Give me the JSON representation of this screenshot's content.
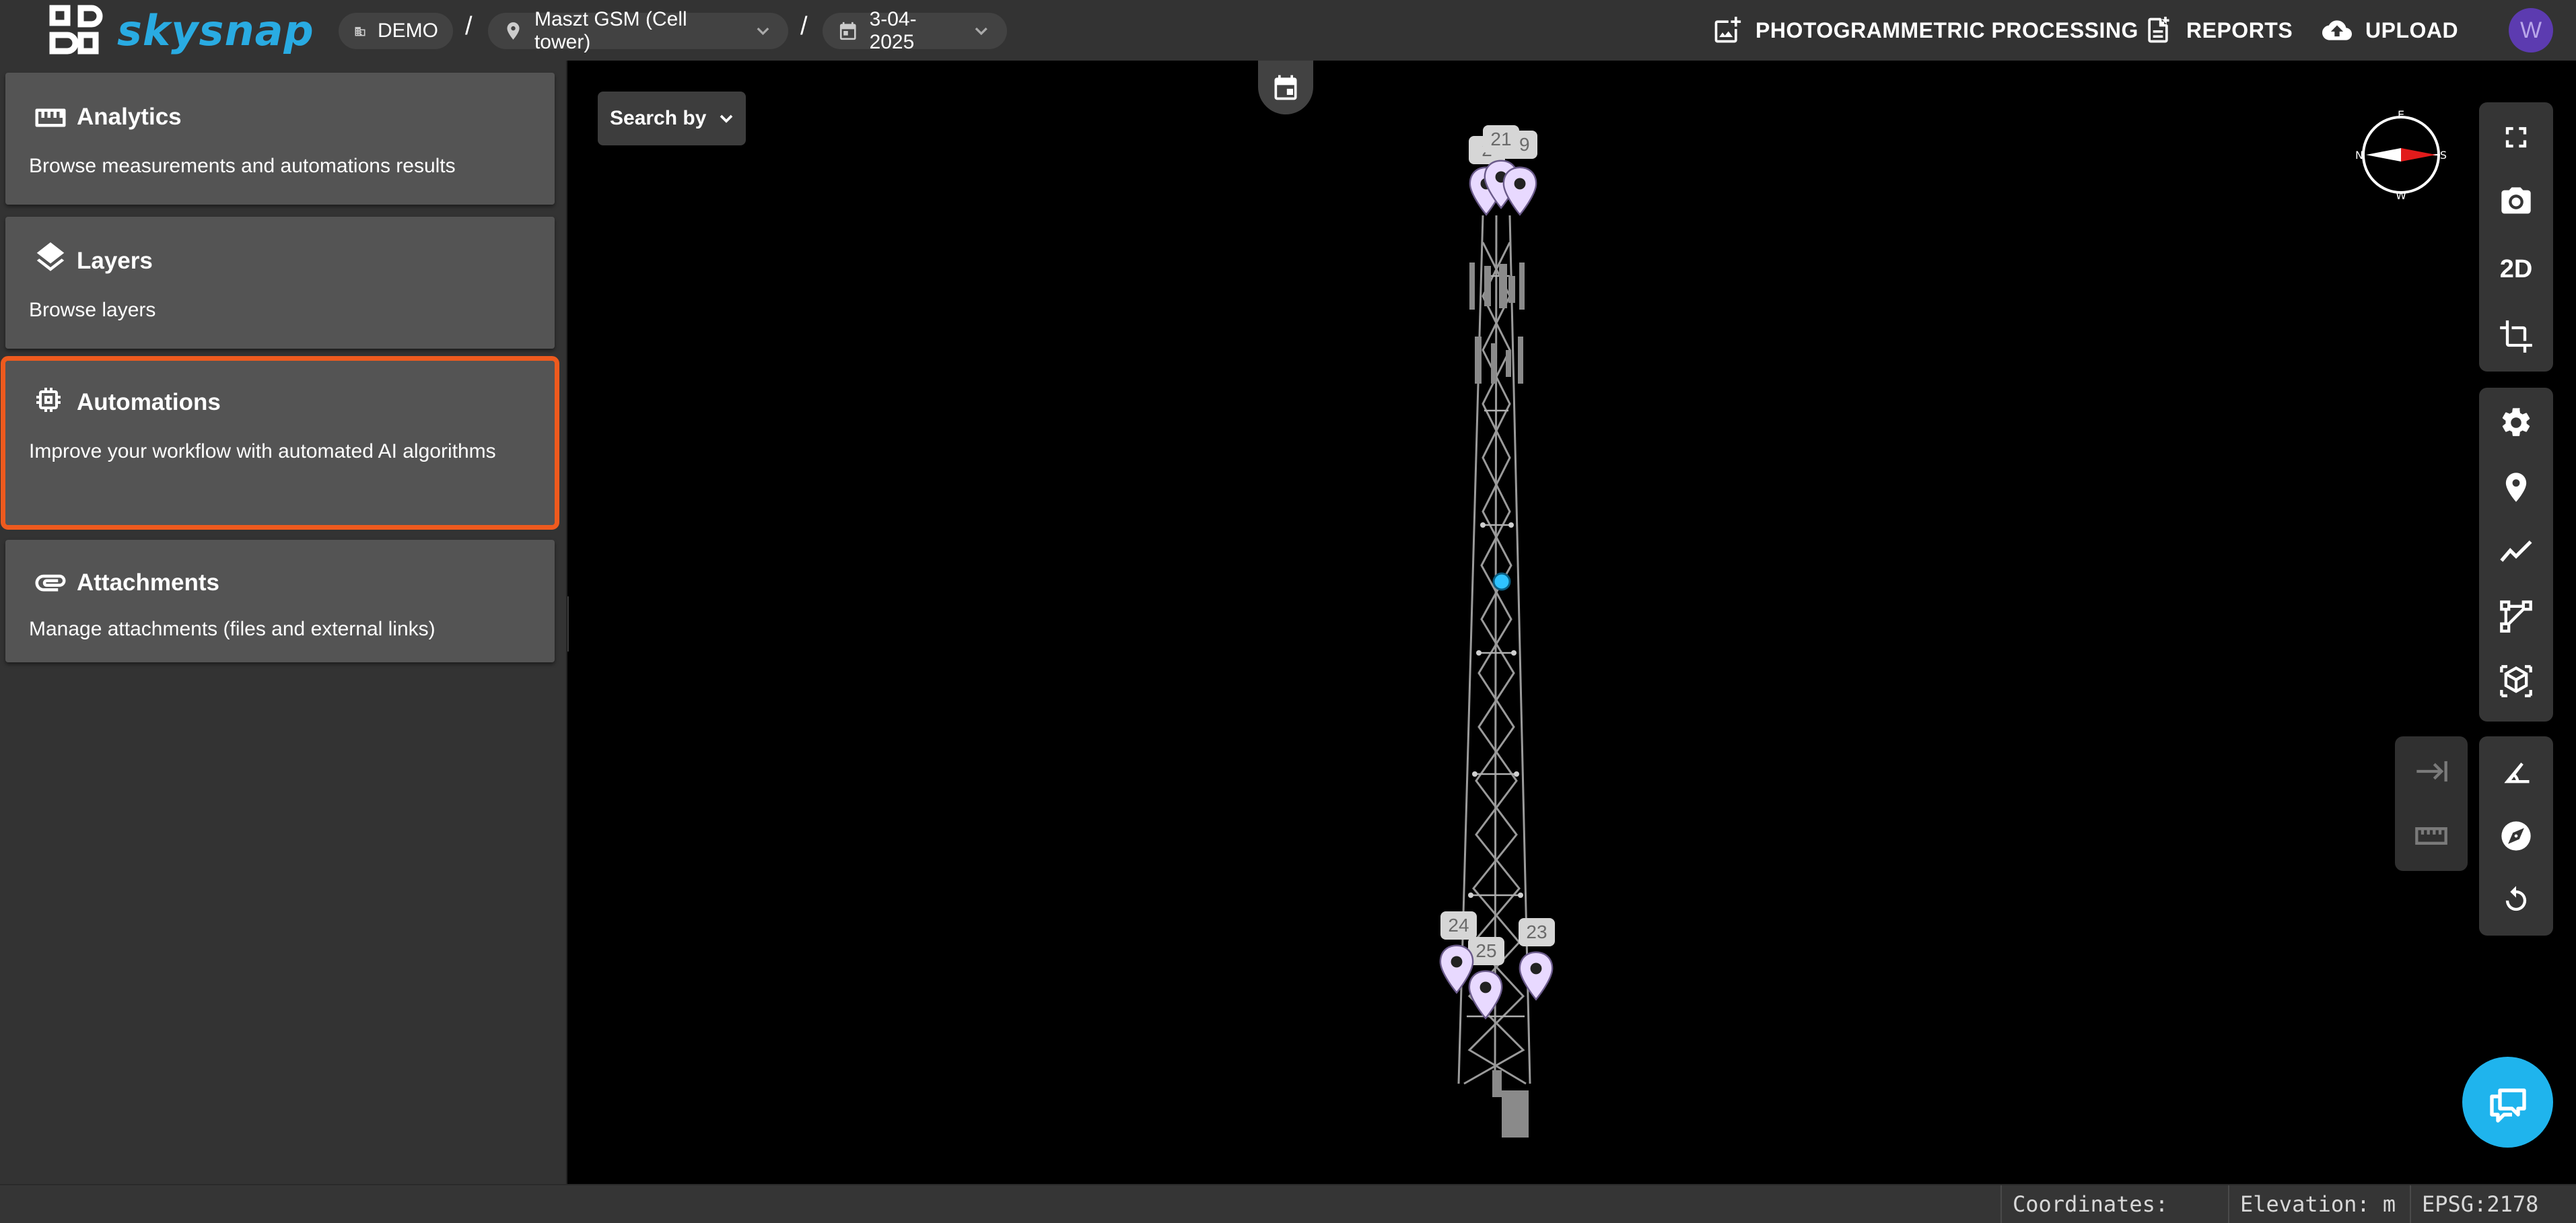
{
  "app": {
    "brand": "skysnap",
    "accent": "#29abe2",
    "selected_outline": "#ee5a1e"
  },
  "breadcrumb": {
    "org": "DEMO",
    "site": "Maszt GSM (Cell tower)",
    "date": "3-04-2025",
    "separator": "/"
  },
  "header_actions": {
    "photogrammetric": "PHOTOGRAMMETRIC PROCESSING",
    "reports": "REPORTS",
    "upload": "UPLOAD",
    "avatar_initial": "W"
  },
  "sidebar": {
    "cards": [
      {
        "title": "Analytics",
        "desc": "Browse measurements and automations results",
        "icon": "ruler-icon"
      },
      {
        "title": "Layers",
        "desc": "Browse layers",
        "icon": "layers-icon"
      },
      {
        "title": "Automations",
        "desc": "Improve your workflow with automated AI algorithms",
        "icon": "chip-icon",
        "selected": true
      },
      {
        "title": "Attachments",
        "desc": "Manage attachments (files and external links)",
        "icon": "paperclip-icon"
      }
    ]
  },
  "viewer": {
    "search_by": "Search by",
    "markers": [
      "21",
      "19",
      "2",
      "24",
      "25",
      "23"
    ]
  },
  "toolbar": {
    "view_mode": "2D",
    "icons": [
      "fullscreen-icon",
      "camera-icon",
      "crop-icon",
      "gear-icon",
      "marker-icon",
      "polyline-icon",
      "polygon-icon",
      "cube-icon",
      "protractor-icon",
      "compass-icon",
      "reset-rotation-icon",
      "arrow-to-end-icon",
      "ruler-icon"
    ]
  },
  "statusbar": {
    "coordinates_label": "Coordinates:",
    "elevation_label": "Elevation: m",
    "epsg": "EPSG:2178"
  }
}
